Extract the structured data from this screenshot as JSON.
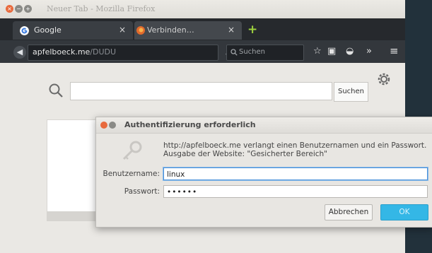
{
  "window": {
    "title": "Neuer Tab - Mozilla Firefox",
    "controls": {
      "close": "×",
      "minimize": "−",
      "maximize": "+"
    }
  },
  "tabs": [
    {
      "label": "Google",
      "close": "×",
      "icon": "google-icon"
    },
    {
      "label": "Verbinden…",
      "close": "×",
      "icon": "firefox-icon"
    }
  ],
  "new_tab": "+",
  "navbar": {
    "back": "◀",
    "url_host": "apfelboeck.me",
    "url_path": "/DUDU",
    "dropdown": "▾",
    "stop": "×",
    "search_placeholder": "Suchen",
    "buttons": {
      "star": "☆",
      "downloads": "▣",
      "pocket": "◒",
      "overflow": "»",
      "menu": "≡"
    }
  },
  "page": {
    "search_button": "Suchen"
  },
  "dialog": {
    "title": "Authentifizierung erforderlich",
    "message_line1": "http://apfelboeck.me verlangt einen Benutzernamen und ein Passwort.",
    "message_line2": "Ausgabe der Website: \"Gesicherter Bereich\"",
    "username_label": "Benutzername:",
    "username_value": "linux",
    "password_label": "Passwort:",
    "password_value": "••••••",
    "cancel_label": "Abbrechen",
    "ok_label": "OK"
  },
  "colors": {
    "accent": "#34b7e6",
    "close": "#e86a3d",
    "new_tab": "#9ed23e"
  }
}
